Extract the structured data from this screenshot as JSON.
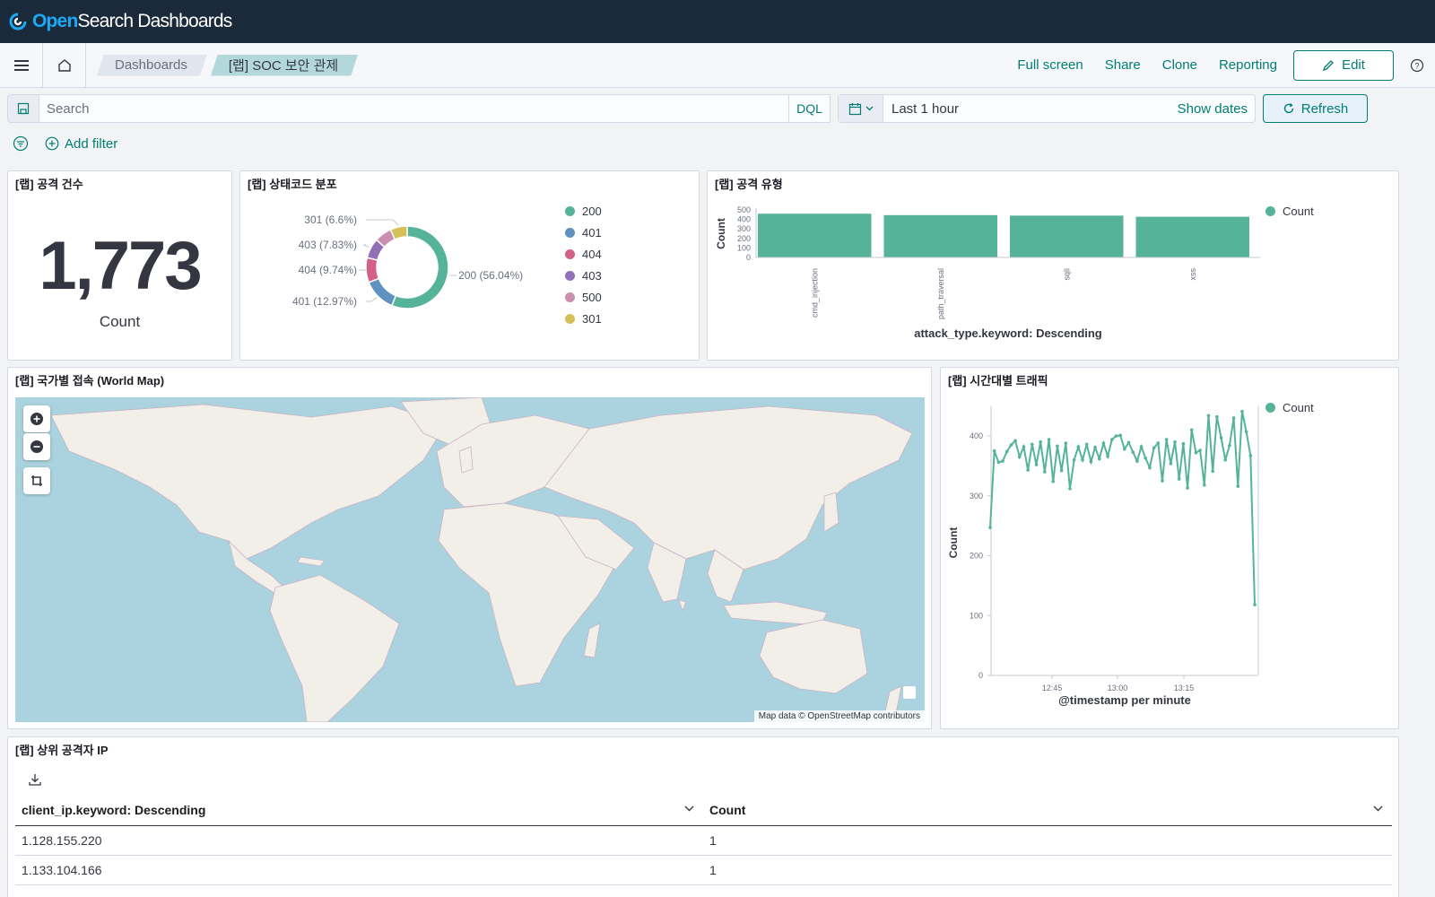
{
  "app": {
    "logo_open": "Open",
    "logo_rest": "Search Dashboards"
  },
  "nav": {
    "breadcrumbs": [
      "Dashboards",
      "[랩] SOC 보안 관제"
    ],
    "actions": [
      "Full screen",
      "Share",
      "Clone",
      "Reporting"
    ],
    "edit_label": "Edit"
  },
  "query": {
    "placeholder": "Search",
    "language": "DQL",
    "time_range": "Last 1 hour",
    "show_dates": "Show dates",
    "refresh_label": "Refresh",
    "add_filter": "Add filter"
  },
  "colors": {
    "accent": "#017d73",
    "header_bg": "#1b2a3a",
    "series_green": "#54b399"
  },
  "panels": {
    "metric": {
      "title": "[랩] 공격 건수",
      "value": "1,773",
      "label": "Count"
    },
    "status": {
      "title": "[랩] 상태코드 분포"
    },
    "attack": {
      "title": "[랩] 공격 유형"
    },
    "map": {
      "title": "[랩] 국가별 접속 (World Map)",
      "attribution": "Map data © OpenStreetMap contributors"
    },
    "traffic": {
      "title": "[랩] 시간대별 트래픽"
    },
    "table": {
      "title": "[랩] 상위 공격자 IP",
      "columns": [
        "client_ip.keyword: Descending",
        "Count"
      ],
      "rows": [
        [
          "1.128.155.220",
          "1"
        ],
        [
          "1.133.104.166",
          "1"
        ]
      ]
    }
  },
  "chart_data": [
    {
      "type": "pie",
      "title": "[랩] 상태코드 분포",
      "donut": true,
      "categories": [
        "200",
        "401",
        "404",
        "403",
        "500",
        "301"
      ],
      "values": [
        56.04,
        12.97,
        9.74,
        7.83,
        6.79,
        6.6
      ],
      "slice_labels": [
        "200 (56.04%)",
        "401 (12.97%)",
        "404 (9.74%)",
        "403 (7.83%)",
        "",
        "301 (6.6%)"
      ],
      "colors": [
        "#54b399",
        "#6092c0",
        "#d36086",
        "#9170b8",
        "#ca8eae",
        "#d6bf57"
      ],
      "legend": "right"
    },
    {
      "type": "bar",
      "title": "[랩] 공격 유형",
      "categories": [
        "cmd_injection",
        "path_traversal",
        "sqli",
        "xss"
      ],
      "series": [
        {
          "name": "Count",
          "values": [
            460,
            445,
            440,
            428
          ]
        }
      ],
      "xlabel": "attack_type.keyword: Descending",
      "ylabel": "Count",
      "ylim": [
        0,
        500
      ],
      "yticks": [
        0,
        100,
        200,
        300,
        400,
        500
      ],
      "legend": "top-right"
    },
    {
      "type": "line",
      "title": "[랩] 시간대별 트래픽",
      "series": [
        {
          "name": "Count",
          "values": [
            247,
            375,
            356,
            358,
            374,
            385,
            392,
            365,
            382,
            343,
            386,
            352,
            390,
            340,
            394,
            324,
            383,
            342,
            388,
            312,
            360,
            382,
            360,
            386,
            357,
            381,
            362,
            388,
            366,
            394,
            400,
            401,
            378,
            389,
            373,
            358,
            382,
            363,
            347,
            380,
            388,
            325,
            394,
            354,
            390,
            328,
            387,
            313,
            410,
            372,
            376,
            318,
            434,
            341,
            432,
            397,
            360,
            384,
            430,
            316,
            441,
            407,
            367,
            118
          ]
        }
      ],
      "xlabel": "@timestamp per minute",
      "ylabel": "Count",
      "xticks": [
        "12:45",
        "13:00",
        "13:15"
      ],
      "yticks": [
        0,
        100,
        200,
        300,
        400
      ],
      "ylim": [
        0,
        450
      ],
      "legend": "top-right"
    }
  ]
}
